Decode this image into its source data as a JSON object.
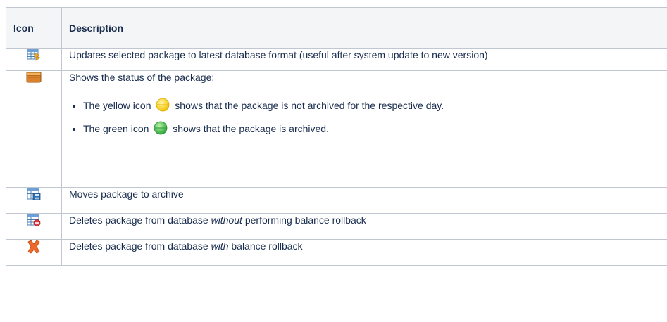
{
  "table": {
    "headers": {
      "icon": "Icon",
      "description": "Description"
    },
    "rows": [
      {
        "icon": "table-update-icon",
        "text": "Updates selected package to latest database format (useful after system update to new version)"
      },
      {
        "icon": "package-box-icon",
        "text": "Shows the status of the package:",
        "bullets": [
          {
            "before": "The yellow icon",
            "icon": "yellow-status-icon",
            "after": "shows that the package is not archived for the respective day."
          },
          {
            "before": "The green icon",
            "icon": "green-status-icon",
            "after": "shows that the package is archived."
          }
        ]
      },
      {
        "icon": "table-archive-icon",
        "text": "Moves package to archive"
      },
      {
        "icon": "table-delete-icon",
        "text_before": "Deletes package from database",
        "text_em": "without",
        "text_after": "performing balance rollback"
      },
      {
        "icon": "delete-x-icon",
        "text_before": "Deletes package from database",
        "text_em": "with",
        "text_after": "balance rollback"
      }
    ]
  },
  "colors": {
    "header_bg": "#f4f5f7",
    "border": "#c1c7d0",
    "yellow": "#f5c400",
    "green": "#39b54a",
    "delete_orange": "#ef6a2a"
  }
}
